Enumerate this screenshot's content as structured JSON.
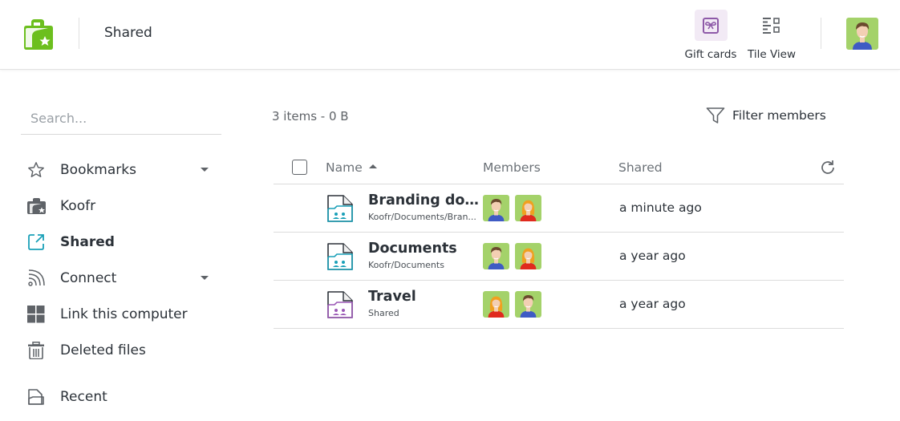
{
  "header": {
    "app_logo": "koofr-logo",
    "title": "Shared",
    "gift_cards_label": "Gift cards",
    "tile_view_label": "Tile View",
    "user_avatar": "male-avatar"
  },
  "sidebar": {
    "search_placeholder": "Search...",
    "items": [
      {
        "label": "Bookmarks",
        "icon": "star-icon",
        "has_caret": true
      },
      {
        "label": "Koofr",
        "icon": "folder-icon"
      },
      {
        "label": "Shared",
        "icon": "share-icon",
        "active": true
      },
      {
        "label": "Connect",
        "icon": "rss-icon",
        "has_caret": true
      },
      {
        "label": "Link this computer",
        "icon": "windows-icon"
      },
      {
        "label": "Deleted files",
        "icon": "trash-icon"
      },
      {
        "label": "Recent",
        "icon": "recent-icon"
      }
    ]
  },
  "main": {
    "summary": "3 items - 0 B",
    "filter_label": "Filter members",
    "columns": {
      "name": "Name",
      "members": "Members",
      "shared": "Shared"
    },
    "rows": [
      {
        "name": "Branding doc...",
        "path": "Koofr/Documents/Bran...",
        "members": [
          "male",
          "female"
        ],
        "shared": "a minute ago",
        "folder_color": "#1aa0b8"
      },
      {
        "name": "Documents",
        "path": "Koofr/Documents",
        "members": [
          "male",
          "female"
        ],
        "shared": "a year ago",
        "folder_color": "#1aa0b8"
      },
      {
        "name": "Travel",
        "path": "Shared",
        "members": [
          "female",
          "male"
        ],
        "shared": "a year ago",
        "folder_color": "#9b59b6"
      }
    ]
  },
  "colors": {
    "brand_green": "#6cbf1e",
    "accent_cyan": "#1aa0b8",
    "gift_purple": "#8e5aa8",
    "avatar_bg": "#a4d26a"
  }
}
